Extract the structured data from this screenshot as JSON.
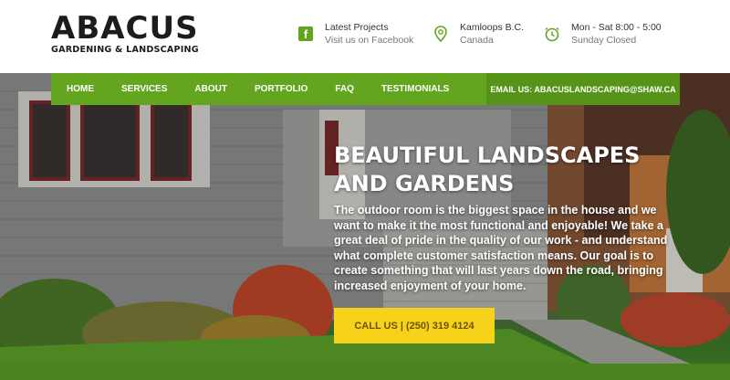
{
  "logo": {
    "title": "ABACUS",
    "subtitle": "GARDENING & LANDSCAPING"
  },
  "header_info": {
    "facebook": {
      "line1": "Latest Projects",
      "line2": "Visit us on Facebook",
      "icon": "facebook-icon"
    },
    "location": {
      "line1": "Kamloops B.C.",
      "line2": "Canada",
      "icon": "map-pin-icon"
    },
    "hours": {
      "line1": "Mon - Sat 8:00 - 5:00",
      "line2": "Sunday Closed",
      "icon": "clock-icon"
    }
  },
  "nav": {
    "items": [
      "HOME",
      "SERVICES",
      "ABOUT",
      "PORTFOLIO",
      "FAQ",
      "TESTIMONIALS"
    ],
    "email": "EMAIL US: ABACUSLANDSCAPING@SHAW.CA"
  },
  "hero": {
    "title_line1": "BEAUTIFUL LANDSCAPES",
    "title_line2": "AND GARDENS",
    "body": "The outdoor room is the biggest space in the house and we want to make it the most functional and enjoyable! We take a great deal of pride in the quality of our work - and understand what complete customer satisfaction means. Our goal is to create something that will last years down the road, bringing increased enjoyment of your home.",
    "cta": "CALL US  |  (250) 319 4124"
  },
  "colors": {
    "brand_green": "#64a51f",
    "cta_yellow": "#f7d21a"
  }
}
